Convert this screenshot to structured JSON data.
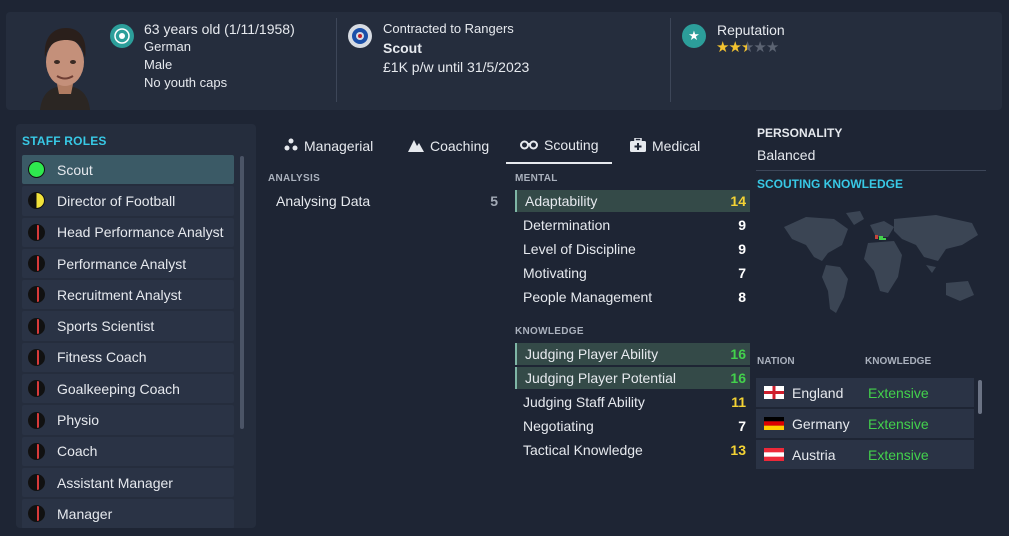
{
  "header": {
    "age_line": "63 years old (1/11/1958)",
    "nationality": "German",
    "gender": "Male",
    "youth_caps": "No youth caps",
    "contract_line": "Contracted to Rangers",
    "job": "Scout",
    "wage_line": "£1K p/w until 31/5/2023",
    "reputation_label": "Reputation",
    "reputation_stars": 2.5,
    "reputation_max": 5
  },
  "staff_roles": {
    "title": "STAFF ROLES",
    "items": [
      {
        "label": "Scout",
        "suitability": "full",
        "color": "#2ee84e",
        "selected": true
      },
      {
        "label": "Director of Football",
        "suitability": "half",
        "color": "#f2e33a",
        "selected": false
      },
      {
        "label": "Head Performance Analyst",
        "suitability": "low",
        "color": "#d83a3a",
        "selected": false
      },
      {
        "label": "Performance Analyst",
        "suitability": "low",
        "color": "#d83a3a",
        "selected": false
      },
      {
        "label": "Recruitment Analyst",
        "suitability": "low",
        "color": "#d83a3a",
        "selected": false
      },
      {
        "label": "Sports Scientist",
        "suitability": "low",
        "color": "#d83a3a",
        "selected": false
      },
      {
        "label": "Fitness Coach",
        "suitability": "low",
        "color": "#d83a3a",
        "selected": false
      },
      {
        "label": "Goalkeeping Coach",
        "suitability": "low",
        "color": "#d83a3a",
        "selected": false
      },
      {
        "label": "Physio",
        "suitability": "low",
        "color": "#d83a3a",
        "selected": false
      },
      {
        "label": "Coach",
        "suitability": "low",
        "color": "#d83a3a",
        "selected": false
      },
      {
        "label": "Assistant Manager",
        "suitability": "low",
        "color": "#d83a3a",
        "selected": false
      },
      {
        "label": "Manager",
        "suitability": "low",
        "color": "#d83a3a",
        "selected": false
      }
    ]
  },
  "tabs": [
    {
      "label": "Managerial",
      "icon": "managerial-icon",
      "active": false
    },
    {
      "label": "Coaching",
      "icon": "coaching-icon",
      "active": false
    },
    {
      "label": "Scouting",
      "icon": "binoculars-icon",
      "active": true
    },
    {
      "label": "Medical",
      "icon": "medical-kit-icon",
      "active": false
    }
  ],
  "analysis": {
    "title": "ANALYSIS",
    "rows": [
      {
        "label": "Analysing Data",
        "value": 5
      }
    ]
  },
  "mental": {
    "title": "MENTAL",
    "rows": [
      {
        "label": "Adaptability",
        "value": 14,
        "highlight": true
      },
      {
        "label": "Determination",
        "value": 9,
        "highlight": false
      },
      {
        "label": "Level of Discipline",
        "value": 9,
        "highlight": false
      },
      {
        "label": "Motivating",
        "value": 7,
        "highlight": false
      },
      {
        "label": "People Management",
        "value": 8,
        "highlight": false
      }
    ]
  },
  "knowledge": {
    "title": "KNOWLEDGE",
    "rows": [
      {
        "label": "Judging Player Ability",
        "value": 16,
        "highlight": true
      },
      {
        "label": "Judging Player Potential",
        "value": 16,
        "highlight": true
      },
      {
        "label": "Judging Staff Ability",
        "value": 11,
        "highlight": false
      },
      {
        "label": "Negotiating",
        "value": 7,
        "highlight": false
      },
      {
        "label": "Tactical Knowledge",
        "value": 13,
        "highlight": false
      }
    ]
  },
  "personality": {
    "title": "PERSONALITY",
    "value": "Balanced"
  },
  "scouting_knowledge": {
    "title": "SCOUTING KNOWLEDGE",
    "col_nation": "NATION",
    "col_knowledge": "KNOWLEDGE",
    "rows": [
      {
        "nation": "England",
        "knowledge": "Extensive",
        "flag": "england-flag-icon"
      },
      {
        "nation": "Germany",
        "knowledge": "Extensive",
        "flag": "germany-flag-icon"
      },
      {
        "nation": "Austria",
        "knowledge": "Extensive",
        "flag": "austria-flag-icon"
      }
    ]
  },
  "colors": {
    "accent": "#38c9e6",
    "value_green": "#43d14c",
    "value_yellow": "#f4d334",
    "star": "#f2c230"
  }
}
